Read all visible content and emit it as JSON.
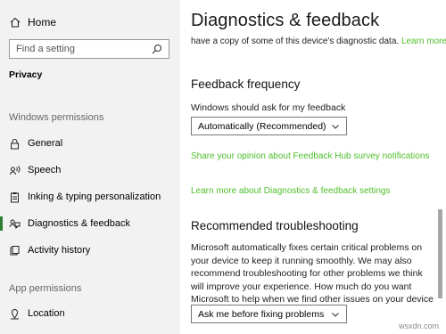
{
  "sidebar": {
    "home_label": "Home",
    "search_placeholder": "Find a setting",
    "breadcrumb": "Privacy",
    "section_windows": "Windows permissions",
    "items": [
      {
        "label": "General",
        "icon": "lock-icon"
      },
      {
        "label": "Speech",
        "icon": "speech-icon"
      },
      {
        "label": "Inking & typing personalization",
        "icon": "clipboard-icon"
      },
      {
        "label": "Diagnostics & feedback",
        "icon": "feedback-icon",
        "active": true
      },
      {
        "label": "Activity history",
        "icon": "history-icon"
      }
    ],
    "section_app": "App permissions",
    "app_items": [
      {
        "label": "Location",
        "icon": "location-icon"
      }
    ]
  },
  "main": {
    "title": "Diagnostics & feedback",
    "cut_text": "have a copy of some of this device's diagnostic data.",
    "cut_link": "Learn more",
    "feedback_heading": "Feedback frequency",
    "feedback_label": "Windows should ask for my feedback",
    "feedback_value": "Automatically (Recommended)",
    "share_link": "Share your opinion about Feedback Hub survey notifications",
    "learn_link": "Learn more about Diagnostics & feedback settings",
    "troubleshoot_heading": "Recommended troubleshooting",
    "troubleshoot_text": "Microsoft automatically fixes certain critical problems on your device to keep it running smoothly. We may also recommend troubleshooting for other problems we think will improve your experience. How much do you want Microsoft to help when we find other issues on your device that we might be able to fix?",
    "troubleshoot_value": "Ask me before fixing problems"
  },
  "watermark": "wsxdn.com",
  "colors": {
    "sidebar_bg": "#f2f2f2",
    "link_green": "#4fbf2b",
    "active_bar": "#2d7d32"
  }
}
